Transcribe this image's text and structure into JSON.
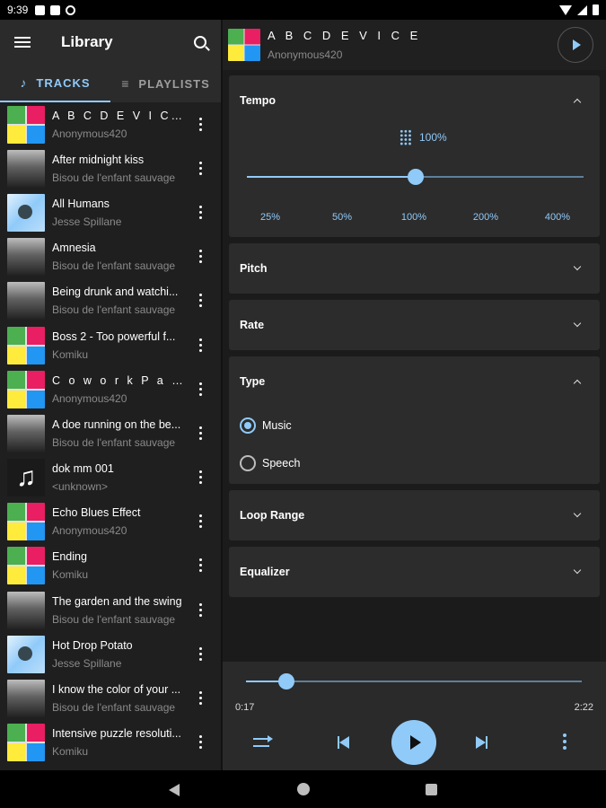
{
  "status_bar": {
    "time": "9:39"
  },
  "library": {
    "title": "Library",
    "tabs": [
      {
        "label": "TRACKS",
        "icon": "music-note-icon"
      },
      {
        "label": "PLAYLISTS",
        "icon": "playlist-icon"
      }
    ],
    "tracks": [
      {
        "title": "A B C D E V I C E",
        "artist": "Anonymous420",
        "art": "colorful"
      },
      {
        "title": "After midnight kiss",
        "artist": "Bisou de l'enfant sauvage",
        "art": "grey"
      },
      {
        "title": "All Humans",
        "artist": "Jesse Spillane",
        "art": "bluecard"
      },
      {
        "title": "Amnesia",
        "artist": "Bisou de l'enfant sauvage",
        "art": "grey"
      },
      {
        "title": "Being drunk and watchi...",
        "artist": "Bisou de l'enfant sauvage",
        "art": "grey"
      },
      {
        "title": "Boss 2 - Too powerful f...",
        "artist": "Komiku",
        "art": "colorful"
      },
      {
        "title": "C o w o r k P a r t...",
        "artist": "Anonymous420",
        "art": "colorful"
      },
      {
        "title": "A doe running on the be...",
        "artist": "Bisou de l'enfant sauvage",
        "art": "grey"
      },
      {
        "title": "dok mm 001",
        "artist": "<unknown>",
        "art": "note"
      },
      {
        "title": "Echo Blues Effect",
        "artist": "Anonymous420",
        "art": "colorful"
      },
      {
        "title": "Ending",
        "artist": "Komiku",
        "art": "colorful"
      },
      {
        "title": "The garden and the swing",
        "artist": "Bisou de l'enfant sauvage",
        "art": "grey"
      },
      {
        "title": "Hot Drop Potato",
        "artist": "Jesse Spillane",
        "art": "bluecard"
      },
      {
        "title": "I know the color of your ...",
        "artist": "Bisou de l'enfant sauvage",
        "art": "grey"
      },
      {
        "title": "Intensive puzzle resoluti...",
        "artist": "Komiku",
        "art": "colorful"
      }
    ]
  },
  "now_playing": {
    "title": "A B C D E V I C E",
    "artist": "Anonymous420"
  },
  "settings": {
    "tempo": {
      "label": "Tempo",
      "value_text": "100%",
      "value_fraction": 0.5,
      "marks": [
        "25%",
        "50%",
        "100%",
        "200%",
        "400%"
      ]
    },
    "pitch": {
      "label": "Pitch"
    },
    "rate": {
      "label": "Rate"
    },
    "type": {
      "label": "Type",
      "options": [
        "Music",
        "Speech"
      ],
      "selected": "Music"
    },
    "loop_range": {
      "label": "Loop Range"
    },
    "equalizer": {
      "label": "Equalizer"
    }
  },
  "player": {
    "elapsed": "0:17",
    "duration": "2:22",
    "progress_fraction": 0.12
  },
  "colors": {
    "accent": "#90caf9",
    "background": "#1b1b1b",
    "card": "#2c2c2c"
  }
}
